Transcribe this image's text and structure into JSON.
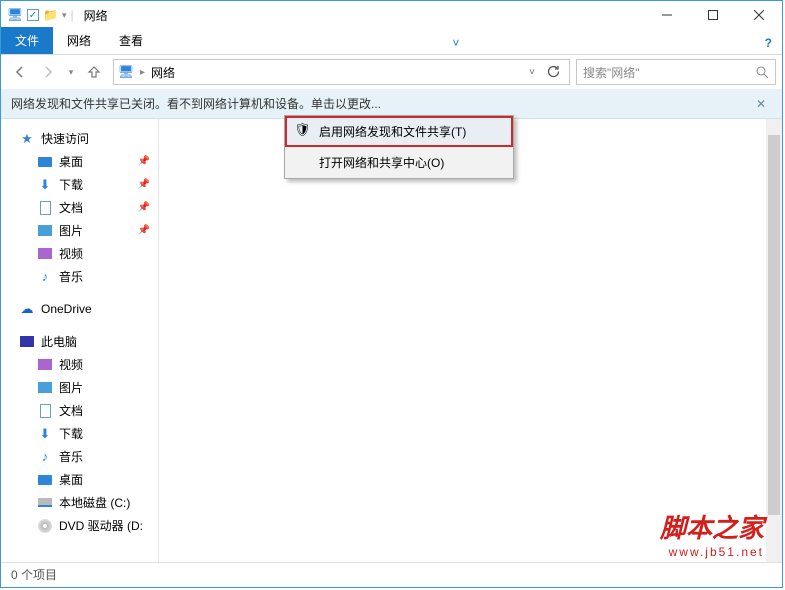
{
  "titlebar": {
    "title": "网络"
  },
  "ribbon": {
    "file": "文件",
    "network": "网络",
    "view": "查看"
  },
  "address": {
    "crumb": "网络",
    "search_placeholder": "搜索\"网络\""
  },
  "infobar": {
    "message": "网络发现和文件共享已关闭。看不到网络计算机和设备。单击以更改..."
  },
  "context_menu": {
    "enable_discovery": "启用网络发现和文件共享(T)",
    "open_center": "打开网络和共享中心(O)"
  },
  "sidebar": {
    "quick_access": "快速访问",
    "desktop": "桌面",
    "downloads": "下载",
    "documents": "文档",
    "pictures": "图片",
    "videos": "视频",
    "music": "音乐",
    "onedrive": "OneDrive",
    "this_pc": "此电脑",
    "pc_videos": "视频",
    "pc_pictures": "图片",
    "pc_documents": "文档",
    "pc_downloads": "下载",
    "pc_music": "音乐",
    "pc_desktop": "桌面",
    "local_disk": "本地磁盘 (C:)",
    "dvd_drive": "DVD 驱动器 (D:"
  },
  "status": {
    "items": "0 个项目"
  },
  "watermark": {
    "line1": "脚本之家",
    "line2": "www.jb51.net"
  }
}
